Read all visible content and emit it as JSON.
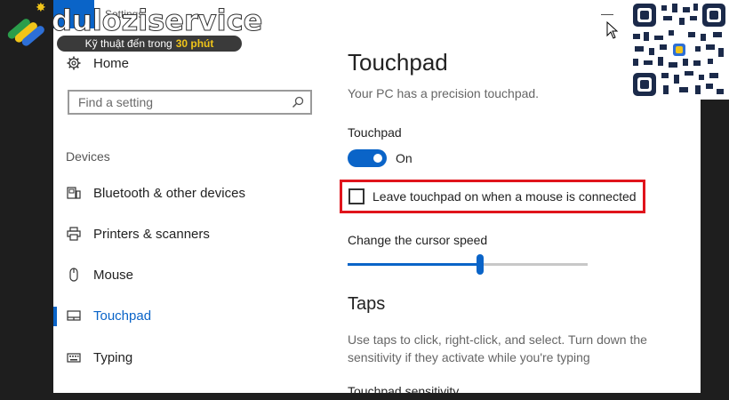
{
  "window": {
    "title": "Settings",
    "minimize_glyph": "—"
  },
  "sidebar": {
    "home_label": "Home",
    "search": {
      "placeholder": "Find a setting",
      "value": ""
    },
    "section_label": "Devices",
    "items": [
      {
        "label": "Bluetooth & other devices",
        "icon": "bluetooth-devices-icon"
      },
      {
        "label": "Printers & scanners",
        "icon": "printer-icon"
      },
      {
        "label": "Mouse",
        "icon": "mouse-icon"
      },
      {
        "label": "Touchpad",
        "icon": "touchpad-icon",
        "selected": true
      },
      {
        "label": "Typing",
        "icon": "keyboard-icon"
      }
    ]
  },
  "main": {
    "title": "Touchpad",
    "subtitle": "Your PC has a precision touchpad.",
    "touchpad_label": "Touchpad",
    "toggle_state": "On",
    "checkbox_label": "Leave touchpad on when a mouse is connected",
    "checkbox_checked": false,
    "cursor_speed_label": "Change the cursor speed",
    "cursor_speed_fraction": 0.55,
    "taps_title": "Taps",
    "taps_description": "Use taps to click, right-click, and select. Turn down the sensitivity if they activate while you're typing",
    "cutoff_label": "Touchpad sensitivity"
  },
  "overlay": {
    "brand_name": "duloziservice",
    "tagline": "Kỹ thuật đến trong",
    "tagline_accent": "30 phút"
  },
  "colors": {
    "accent": "#0a64c8",
    "highlight": "#e0141c"
  }
}
